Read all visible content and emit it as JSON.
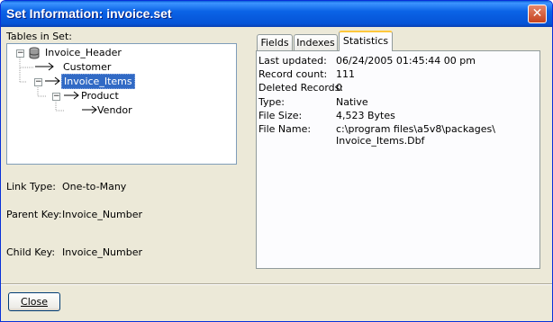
{
  "window": {
    "title": "Set Information: invoice.set",
    "close_symbol": "✕"
  },
  "tree": {
    "label": "Tables in Set:",
    "nodes": [
      {
        "label": "Invoice_Header",
        "expander": "−",
        "icon": "database-icon",
        "depth": 0
      },
      {
        "label": "Customer",
        "icon": "arrow-right-icon",
        "depth": 1
      },
      {
        "label": "Invoice_Items",
        "expander": "−",
        "icon": "arrow-right-icon",
        "depth": 1,
        "selected": true
      },
      {
        "label": "Product",
        "expander": "−",
        "icon": "arrow-right-icon",
        "depth": 2
      },
      {
        "label": "Vendor",
        "icon": "arrow-right-icon",
        "depth": 3
      }
    ]
  },
  "link": {
    "type_label": "Link Type:",
    "type_value": "One-to-Many",
    "parent_label": "Parent Key:",
    "parent_value": "Invoice_Number",
    "child_label": "Child Key:",
    "child_value": "Invoice_Number"
  },
  "tabs": [
    {
      "label": "Fields",
      "active": false
    },
    {
      "label": "Indexes",
      "active": false
    },
    {
      "label": "Statistics",
      "active": true
    }
  ],
  "stats": {
    "last_updated_label": "Last updated:",
    "last_updated": "06/24/2005 01:45:44 00 pm",
    "record_count_label": "Record count:",
    "record_count": "111",
    "deleted_label": "Deleted Records:",
    "deleted": "0",
    "type_label": "Type:",
    "type": "Native",
    "file_size_label": "File Size:",
    "file_size": "4,523 Bytes",
    "file_name_label": "File Name:",
    "file_name_line1": "c:\\program files\\a5v8\\packages\\",
    "file_name_line2": "Invoice_Items.Dbf"
  },
  "footer": {
    "close_label": "Close"
  },
  "colors": {
    "selection": "#316AC5",
    "titlebar": "#0553D6",
    "dialog_bg": "#ECE9D8",
    "tab_highlight": "#FFC83C"
  }
}
